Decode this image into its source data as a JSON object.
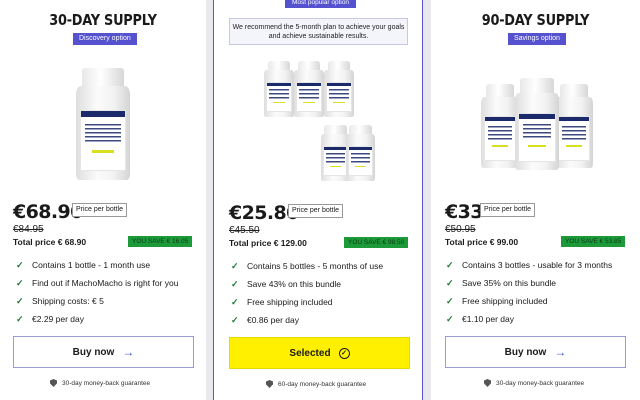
{
  "plans": [
    {
      "title": "30-DAY SUPPLY",
      "tag": "Discovery option",
      "price": "€68.90",
      "per_bottle": "Price per bottle",
      "old_price": "€84.95",
      "total": "Total price € 68.90",
      "save": "YOU SAVE € 16.05",
      "features": [
        "Contains 1 bottle - 1 month use",
        "Find out if MachoMacho is right for you",
        "Shipping costs: € 5",
        "€2.29 per day"
      ],
      "button": "Buy now",
      "button_icon": "arrow-right-icon",
      "guarantee": "30-day money-back guarantee"
    },
    {
      "top_tag": "Most popular option",
      "note": "We recommend the 5-month plan to achieve your goals and achieve sustainable results.",
      "price": "€25.80",
      "per_bottle": "Price per bottle",
      "old_price": "€45.50",
      "total": "Total price € 129.00",
      "save": "YOU SAVE € 98.50",
      "features": [
        "Contains 5 bottles - 5 months of use",
        "Save 43% on this bundle",
        "Free shipping included",
        "€0.86 per day"
      ],
      "button": "Selected",
      "button_icon": "check-circle-icon",
      "guarantee": "60-day money-back guarantee"
    },
    {
      "title": "90-DAY SUPPLY",
      "tag": "Savings option",
      "price": "€33",
      "per_bottle": "Price per bottle",
      "old_price": "€50.95",
      "total": "Total price € 99.00",
      "save": "YOU SAVE € 53.85",
      "features": [
        "Contains 3 bottles - usable for 3 months",
        "Save 35% on this bundle",
        "Free shipping included",
        "€1.10 per day"
      ],
      "button": "Buy now",
      "button_icon": "arrow-right-icon",
      "guarantee": "30-day money-back guarantee"
    }
  ],
  "colors": {
    "accent": "#5552cf",
    "save_green": "#1c9a3a",
    "selected_yellow": "#fff000",
    "check_green": "#1d7a35"
  }
}
